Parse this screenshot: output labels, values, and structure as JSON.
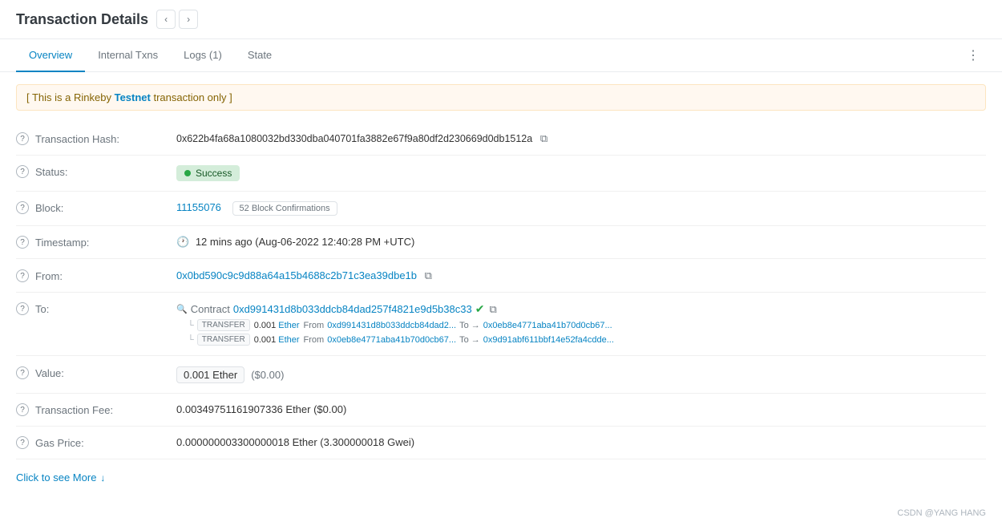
{
  "header": {
    "title": "Transaction Details",
    "prev_arrow": "‹",
    "next_arrow": "›"
  },
  "tabs": [
    {
      "label": "Overview",
      "active": true
    },
    {
      "label": "Internal Txns",
      "active": false
    },
    {
      "label": "Logs (1)",
      "active": false
    },
    {
      "label": "State",
      "active": false
    }
  ],
  "testnet_banner": {
    "prefix": "[ This is a Rinkeby ",
    "highlight": "Testnet",
    "suffix": " transaction only ]"
  },
  "fields": {
    "transaction_hash": {
      "label": "Transaction Hash:",
      "value": "0x622b4fa68a1080032bd330dba040701fa3882e67f9a80df2d230669d0db1512a"
    },
    "status": {
      "label": "Status:",
      "value": "Success"
    },
    "block": {
      "label": "Block:",
      "number": "11155076",
      "confirmations": "52 Block Confirmations"
    },
    "timestamp": {
      "label": "Timestamp:",
      "value": "12 mins ago (Aug-06-2022 12:40:28 PM +UTC)"
    },
    "from": {
      "label": "From:",
      "value": "0x0bd590c9c9d88a64a15b4688c2b71c3ea39dbe1b"
    },
    "to": {
      "label": "To:",
      "contract_label": "Contract",
      "contract_address": "0xd991431d8b033ddcb84dad257f4821e9d5b38c33",
      "transfers": [
        {
          "type": "TRANSFER",
          "amount": "0.001",
          "token": "Ether",
          "from": "0xd991431d8b033ddcb84dad2...",
          "to": "0x0eb8e4771aba41b70d0cb67..."
        },
        {
          "type": "TRANSFER",
          "amount": "0.001",
          "token": "Ether",
          "from": "0x0eb8e4771aba41b70d0cb67...",
          "to": "0x9d91abf611bbf14e52fa4cdde..."
        }
      ]
    },
    "value": {
      "label": "Value:",
      "amount": "0.001 Ether",
      "usd": "($0.00)"
    },
    "transaction_fee": {
      "label": "Transaction Fee:",
      "value": "0.00349751161907336 Ether ($0.00)"
    },
    "gas_price": {
      "label": "Gas Price:",
      "value": "0.000000003300000018 Ether (3.300000018 Gwei)"
    }
  },
  "click_more": {
    "text": "Click to see More",
    "arrow": "↓"
  },
  "footer": {
    "credit": "CSDN @YANG HANG"
  }
}
